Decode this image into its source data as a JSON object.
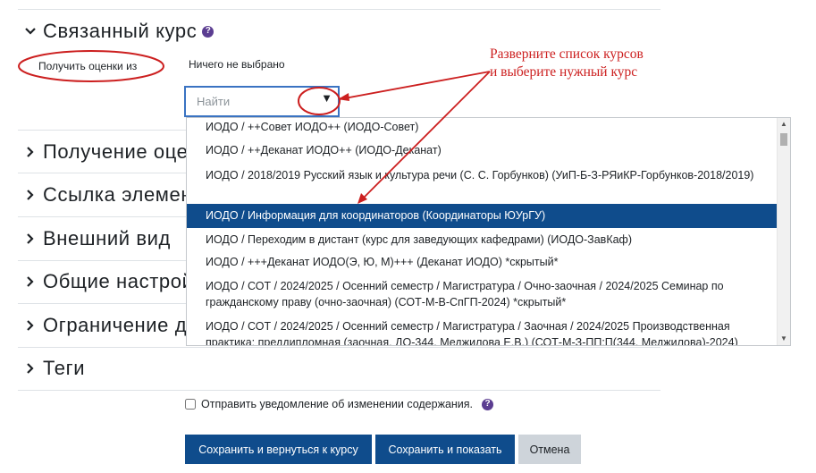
{
  "sections": {
    "linked_course": {
      "title": "Связанный курс",
      "expanded": true
    },
    "grading": {
      "title": "Получение оценок"
    },
    "element_link": {
      "title": "Ссылка элемента"
    },
    "appearance": {
      "title": "Внешний вид"
    },
    "common": {
      "title": "Общие настройки"
    },
    "restrictions": {
      "title": "Ограничение доступа"
    },
    "tags": {
      "title": "Теги"
    }
  },
  "form": {
    "grades_from_label": "Получить оценки из",
    "selected_value": "Ничего не выбрано",
    "search_placeholder": "Найти",
    "help_icon": "?",
    "dropdown_arrow": "▼"
  },
  "dropdown": {
    "options": [
      "ИОДО / ++Совет ИОДО++ (ИОДО-Совет)",
      "ИОДО / ++Деканат ИОДО++ (ИОДО-Деканат)",
      "ИОДО / 2018/2019 Русский язык и культура речи (С. С. Горбунков) (УиП-Б-З-РЯиКР-Горбунков-2018/2019)",
      "ИОДО / Информация для координаторов (Координаторы ЮУрГУ)",
      "ИОДО / Переходим в дистант (курс для заведующих кафедрами) (ИОДО-ЗавКаф)",
      "ИОДО / +++Деканат ИОДО(Э, Ю, М)+++ (Деканат ИОДО) *скрытый*",
      "ИОДО / СОТ / 2024/2025 / Осенний семестр / Магистратура / Очно-заочная / 2024/2025 Семинар по гражданскому праву (очно-заочная) (СОТ-М-В-СпГП-2024) *скрытый*",
      "ИОДО / СОТ / 2024/2025 / Осенний семестр / Магистратура / Заочная / 2024/2025 Производственная практика: преддипломная (заочная, ДО-344, Меджилова Е.В.) (СОТ-М-З-ПП:П(344, Меджилова)-2024)"
    ],
    "selected_index": 3
  },
  "notify": {
    "label": "Отправить уведомление об изменении содержания.",
    "checked": false
  },
  "buttons": {
    "save_return": "Сохранить и вернуться к курсу",
    "save_show": "Сохранить и показать",
    "cancel": "Отмена"
  },
  "annotation": {
    "line1": "Разверните список курсов",
    "line2": "и выберите нужный курс"
  },
  "colors": {
    "primary": "#0f4c8c",
    "secondary": "#ced4da",
    "annotation": "#cc1f1f",
    "help": "#5b3d91",
    "focus_border": "#3a73c2"
  }
}
